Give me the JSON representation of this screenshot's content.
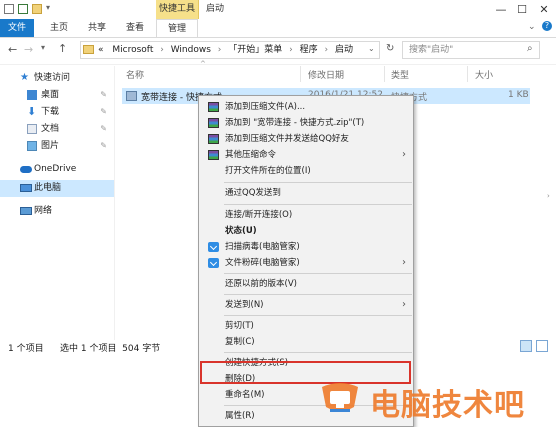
{
  "window": {
    "contextual_tab_group": "快捷工具",
    "title": "启动",
    "controls": {
      "minimize": "—",
      "maximize": "☐",
      "close": "✕"
    }
  },
  "ribbon_tabs": [
    {
      "label": "文件"
    },
    {
      "label": "主页"
    },
    {
      "label": "共享"
    },
    {
      "label": "查看"
    },
    {
      "label": "管理"
    }
  ],
  "address": {
    "overflow": "«",
    "crumbs": [
      "Microsoft",
      "Windows",
      "「开始」菜单",
      "程序",
      "启动"
    ],
    "search_placeholder": "搜索\"启动\""
  },
  "sidebar": {
    "items": [
      {
        "label": "快速访问",
        "icon": "star-icon",
        "pinned": false
      },
      {
        "label": "桌面",
        "icon": "desktop-icon",
        "pinned": true
      },
      {
        "label": "下载",
        "icon": "download-icon",
        "pinned": true
      },
      {
        "label": "文档",
        "icon": "document-icon",
        "pinned": true
      },
      {
        "label": "图片",
        "icon": "picture-icon",
        "pinned": true
      },
      {
        "label": "OneDrive",
        "icon": "cloud-icon",
        "pinned": false
      },
      {
        "label": "此电脑",
        "icon": "computer-icon",
        "pinned": false
      },
      {
        "label": "网络",
        "icon": "network-icon",
        "pinned": false
      }
    ],
    "pin_glyph": "📌"
  },
  "columns": {
    "name": "名称",
    "modified": "修改日期",
    "type": "类型",
    "size": "大小"
  },
  "file": {
    "name": "宽带连接 - 快捷方式",
    "modified": "2016/1/21 12:52",
    "type": "快捷方式",
    "size": "1 KB"
  },
  "status": {
    "count": "1 个项目",
    "selected": "选中 1 个项目  504 字节"
  },
  "context_menu": {
    "items": [
      {
        "label": "添加到压缩文件(A)...",
        "icon": "winrar-icon",
        "submenu": false
      },
      {
        "label": "添加到 \"宽带连接 - 快捷方式.zip\"(T)",
        "icon": "winrar-icon",
        "submenu": false
      },
      {
        "label": "添加到压缩文件并发送给QQ好友",
        "icon": "winrar-icon",
        "submenu": false
      },
      {
        "label": "其他压缩命令",
        "icon": "winrar-icon",
        "submenu": true
      },
      {
        "label": "打开文件所在的位置(I)",
        "icon": "",
        "submenu": false
      },
      {
        "label": "通过QQ发送到",
        "icon": "",
        "submenu": false
      },
      {
        "label": "连接/断开连接(O)",
        "icon": "",
        "submenu": false
      },
      {
        "label": "状态(U)",
        "icon": "",
        "submenu": false,
        "bold": true
      },
      {
        "label": "扫描病毒(电脑管家)",
        "icon": "shield-icon",
        "submenu": false
      },
      {
        "label": "文件粉碎(电脑管家)",
        "icon": "shield-icon",
        "submenu": true
      },
      {
        "label": "还原以前的版本(V)",
        "icon": "",
        "submenu": false
      },
      {
        "label": "发送到(N)",
        "icon": "",
        "submenu": true
      },
      {
        "label": "剪切(T)",
        "icon": "",
        "submenu": false
      },
      {
        "label": "复制(C)",
        "icon": "",
        "submenu": false
      },
      {
        "label": "创建快捷方式(S)",
        "icon": "",
        "submenu": false
      },
      {
        "label": "删除(D)",
        "icon": "",
        "submenu": false,
        "highlighted": true
      },
      {
        "label": "重命名(M)",
        "icon": "",
        "submenu": false
      },
      {
        "label": "属性(R)",
        "icon": "",
        "submenu": false
      }
    ],
    "submenu_arrow": "›"
  },
  "watermark": {
    "text": "电脑技术吧"
  },
  "colors": {
    "file_tab": "#1979ca",
    "contextual_tab": "#f6e08a",
    "selection": "#cce8ff",
    "highlight_box": "#d9342b",
    "watermark": "#ee7a2a"
  }
}
